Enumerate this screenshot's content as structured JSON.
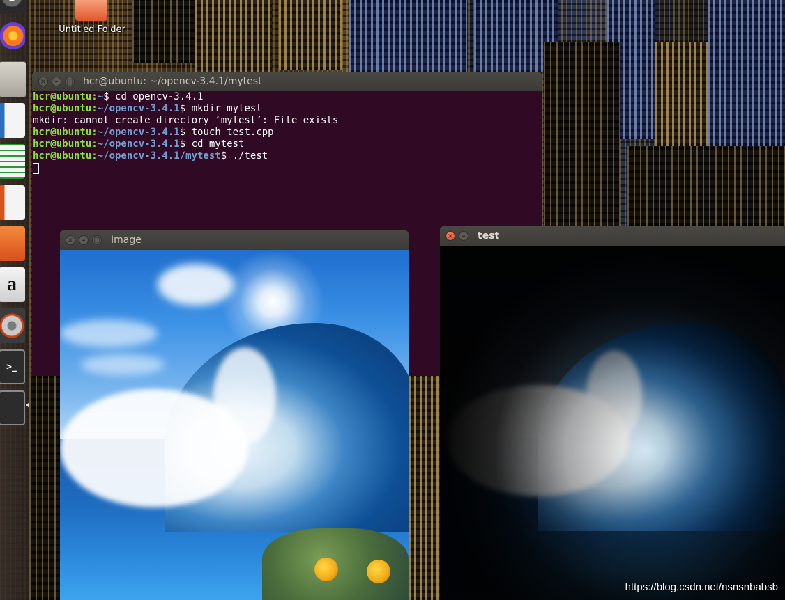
{
  "desktop": {
    "folder_label": "Untitled Folder",
    "watermark": "https://blog.csdn.net/nsnsnbabsb"
  },
  "launcher": {
    "items": [
      {
        "icon": "dash-icon"
      },
      {
        "icon": "firefox-icon"
      },
      {
        "icon": "files-icon"
      },
      {
        "icon": "libreoffice-writer-icon"
      },
      {
        "icon": "libreoffice-calc-icon"
      },
      {
        "icon": "libreoffice-impress-icon"
      },
      {
        "icon": "ubuntu-software-icon"
      },
      {
        "icon": "amazon-icon",
        "glyph": "a"
      },
      {
        "icon": "system-settings-icon"
      },
      {
        "icon": "terminal-icon",
        "glyph": ">_"
      },
      {
        "icon": "terminal-icon-2"
      }
    ]
  },
  "terminal": {
    "title": "hcr@ubuntu: ~/opencv-3.4.1/mytest",
    "lines": [
      {
        "user": "hcr@ubuntu",
        "path": "~",
        "cmd": " cd opencv-3.4.1"
      },
      {
        "user": "hcr@ubuntu",
        "path": "~/opencv-3.4.1",
        "cmd": " mkdir mytest"
      },
      {
        "text": "mkdir: cannot create directory ‘mytest’: File exists"
      },
      {
        "user": "hcr@ubuntu",
        "path": "~/opencv-3.4.1",
        "cmd": " touch test.cpp"
      },
      {
        "user": "hcr@ubuntu",
        "path": "~/opencv-3.4.1",
        "cmd": " cd mytest"
      },
      {
        "user": "hcr@ubuntu",
        "path": "~/opencv-3.4.1/mytest",
        "cmd": " ./test"
      }
    ],
    "prompt_sep": ":",
    "prompt_dollar": "$"
  },
  "image_window": {
    "title": "Image"
  },
  "test_window": {
    "title": "test"
  },
  "colors": {
    "terminal_bg": "#300a24",
    "prompt_user": "#8ae234",
    "prompt_path": "#729fcf",
    "titlebar": "#3c3b37"
  }
}
